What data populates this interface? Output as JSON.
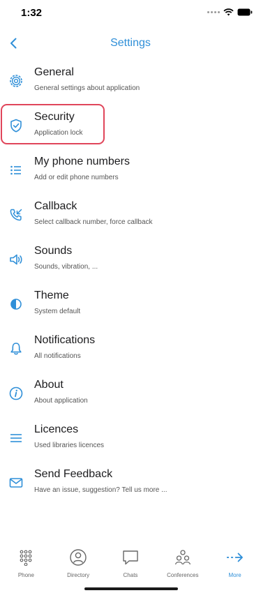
{
  "status_bar": {
    "time": "1:32"
  },
  "header": {
    "title": "Settings",
    "back_icon": "chevron-left-icon"
  },
  "colors": {
    "accent": "#2f8fd8",
    "highlight": "#e0455a"
  },
  "settings": [
    {
      "title": "General",
      "subtitle": "General settings about application",
      "icon": "gear-icon"
    },
    {
      "title": "Security",
      "subtitle": "Application lock",
      "icon": "shield-icon"
    },
    {
      "title": "My phone numbers",
      "subtitle": "Add or edit phone numbers",
      "icon": "list-icon"
    },
    {
      "title": "Callback",
      "subtitle": "Select callback number, force callback",
      "icon": "phone-callback-icon"
    },
    {
      "title": "Sounds",
      "subtitle": "Sounds, vibration, ...",
      "icon": "speaker-icon"
    },
    {
      "title": "Theme",
      "subtitle": "System default",
      "icon": "theme-icon"
    },
    {
      "title": "Notifications",
      "subtitle": "All notifications",
      "icon": "bell-icon"
    },
    {
      "title": "About",
      "subtitle": "About application",
      "icon": "info-icon"
    },
    {
      "title": "Licences",
      "subtitle": "Used libraries licences",
      "icon": "menu-lines-icon"
    },
    {
      "title": "Send Feedback",
      "subtitle": "Have an issue, suggestion? Tell us more ...",
      "icon": "envelope-icon"
    }
  ],
  "tabs": [
    {
      "label": "Phone",
      "icon": "dialpad-icon"
    },
    {
      "label": "Directory",
      "icon": "contact-icon"
    },
    {
      "label": "Chats",
      "icon": "chat-icon"
    },
    {
      "label": "Conferences",
      "icon": "group-icon"
    },
    {
      "label": "More",
      "icon": "arrow-right-icon",
      "active": true
    }
  ]
}
